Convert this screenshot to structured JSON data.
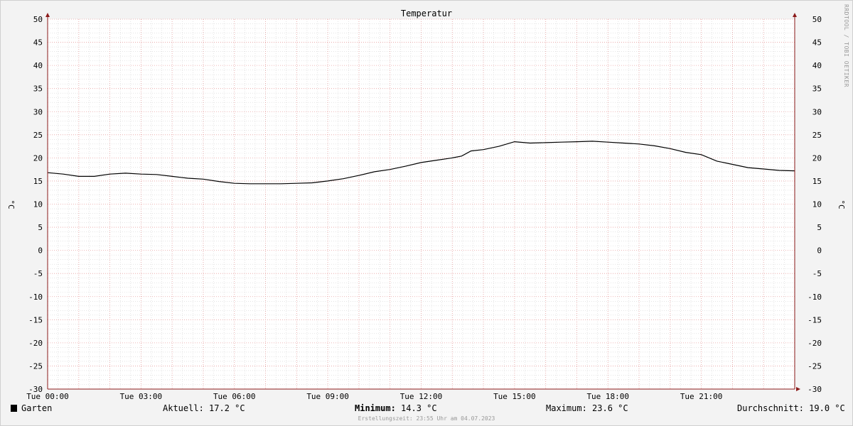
{
  "chart_data": {
    "type": "line",
    "title": "Temperatur",
    "ylabel": "°C",
    "xlabel": "",
    "ylim": [
      -30,
      50
    ],
    "xlim": [
      0,
      24
    ],
    "yticks": [
      "50",
      "45",
      "40",
      "35",
      "30",
      "25",
      "20",
      "15",
      "10",
      "5",
      "0",
      "-5",
      "-10",
      "-15",
      "-20",
      "-25",
      "-30"
    ],
    "xticks": [
      {
        "hour": 0,
        "label": "Tue 00:00"
      },
      {
        "hour": 3,
        "label": "Tue 03:00"
      },
      {
        "hour": 6,
        "label": "Tue 06:00"
      },
      {
        "hour": 9,
        "label": "Tue 09:00"
      },
      {
        "hour": 12,
        "label": "Tue 12:00"
      },
      {
        "hour": 15,
        "label": "Tue 15:00"
      },
      {
        "hour": 18,
        "label": "Tue 18:00"
      },
      {
        "hour": 21,
        "label": "Tue 21:00"
      }
    ],
    "grid": true,
    "series": [
      {
        "name": "Garten",
        "color": "#000000",
        "x": [
          0,
          0.5,
          1.0,
          1.5,
          2.0,
          2.5,
          3.0,
          3.5,
          4.0,
          4.5,
          5.0,
          5.5,
          6.0,
          6.5,
          7.0,
          7.5,
          8.0,
          8.5,
          9.0,
          9.5,
          10.0,
          10.5,
          11.0,
          11.5,
          12.0,
          12.5,
          13.0,
          13.3,
          13.6,
          14.0,
          14.5,
          15.0,
          15.5,
          16.0,
          16.5,
          17.0,
          17.5,
          18.0,
          18.5,
          19.0,
          19.5,
          20.0,
          20.5,
          21.0,
          21.5,
          22.0,
          22.5,
          23.0,
          23.5,
          24.0
        ],
        "values": [
          16.8,
          16.5,
          16.0,
          16.0,
          16.5,
          16.7,
          16.5,
          16.4,
          16.0,
          15.6,
          15.4,
          14.9,
          14.5,
          14.4,
          14.4,
          14.4,
          14.5,
          14.6,
          15.0,
          15.5,
          16.2,
          17.0,
          17.5,
          18.2,
          19.0,
          19.5,
          20.0,
          20.4,
          21.5,
          21.8,
          22.5,
          23.5,
          23.2,
          23.3,
          23.4,
          23.5,
          23.6,
          23.4,
          23.2,
          23.0,
          22.6,
          22.0,
          21.2,
          20.7,
          19.3,
          18.6,
          17.9,
          17.6,
          17.3,
          17.2
        ]
      }
    ]
  },
  "legend": {
    "series_name": "Garten",
    "current": "Aktuell: 17.2 °C",
    "minimum_label": "Minimum:",
    "minimum_value": " 14.3 °C",
    "maximum": "Maximum: 23.6 °C",
    "average": "Durchschnitt: 19.0 °C"
  },
  "footer": "Erstellungszeit: 23:55 Uhr am 04.07.2023",
  "watermark": "RRDTOOL / TOBI OETIKER",
  "colors": {
    "background": "#f3f3f3",
    "plot_background": "#ffffff",
    "major_grid": "#e8a0a0",
    "minor_grid": "#d4d4d4",
    "axis": "#8b1a1a",
    "line": "#000000"
  }
}
